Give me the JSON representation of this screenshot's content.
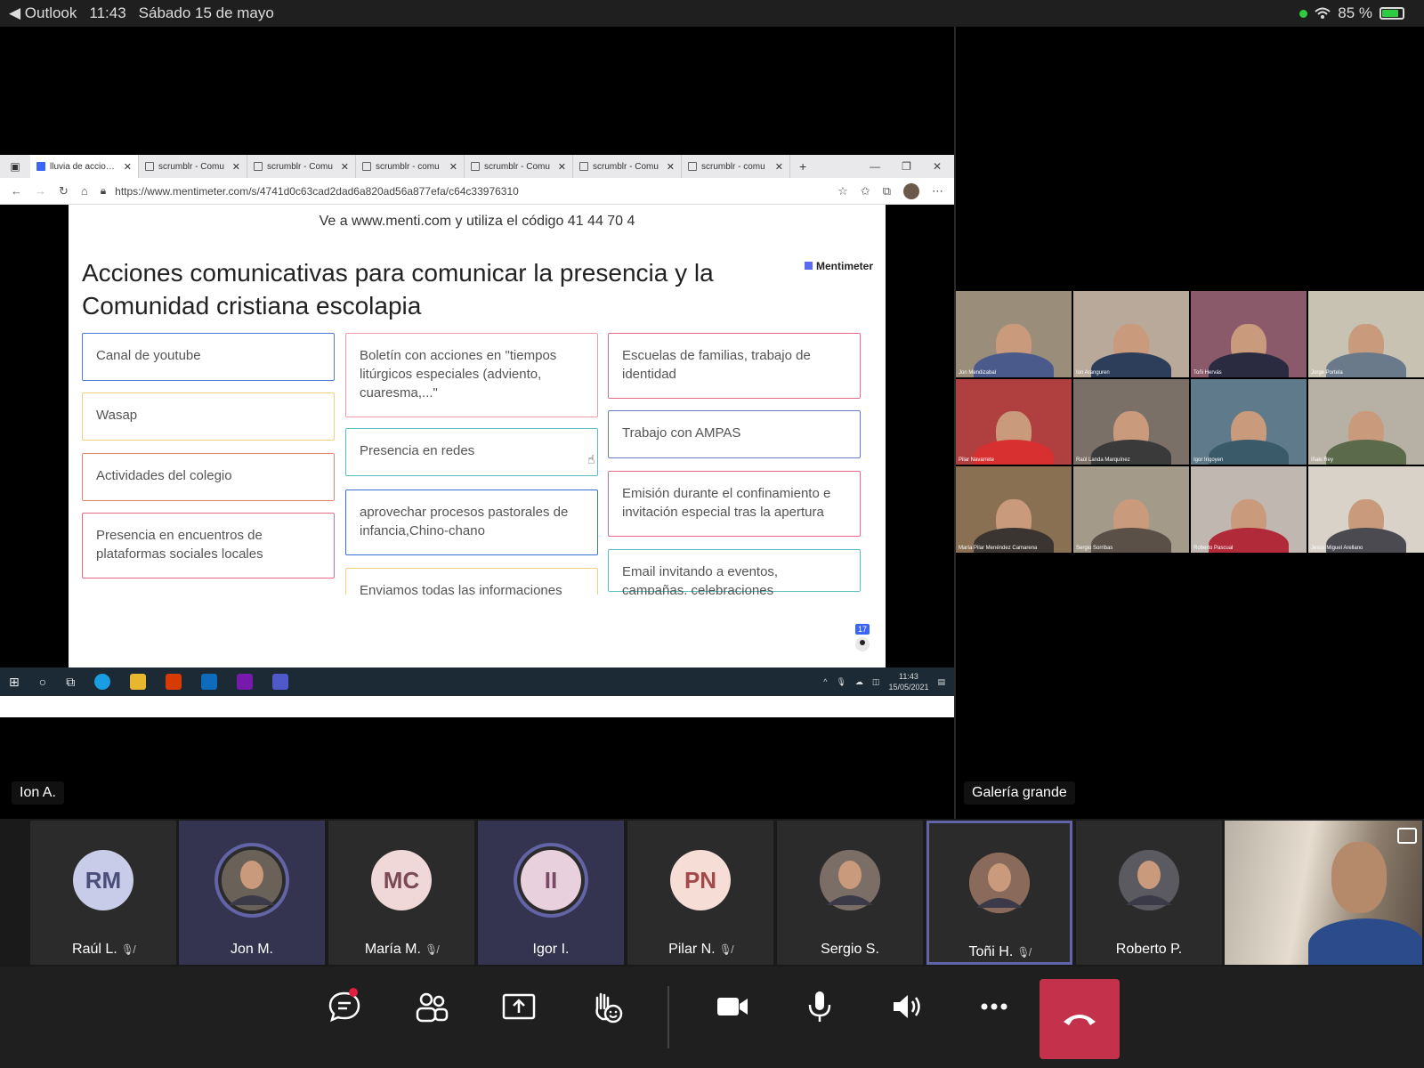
{
  "status_bar": {
    "back_app": "Outlook",
    "time": "11:43",
    "date": "Sábado 15 de mayo",
    "battery": "85 %",
    "battery_level": 0.85
  },
  "browser": {
    "tabs": [
      {
        "label": "lluvia de acciones"
      },
      {
        "label": "scrumblr - Comu"
      },
      {
        "label": "scrumblr - Comu"
      },
      {
        "label": "scrumblr - comu"
      },
      {
        "label": "scrumblr - Comu"
      },
      {
        "label": "scrumblr - Comu"
      },
      {
        "label": "scrumblr - comu"
      }
    ],
    "new_tab": "+",
    "url": "https://www.mentimeter.com/s/4741d0c63cad2dad6a820ad56a877efa/c64c33976310"
  },
  "slide": {
    "instruction": "Ve a www.menti.com y utiliza el código 41 44 70 4",
    "title": "Acciones comunicativas para comunicar la presencia y la Comunidad cristiana escolapia",
    "brand": "Mentimeter",
    "participants_count": "17",
    "columns": [
      [
        {
          "text": "Canal de youtube",
          "color": "#4a7fd6"
        },
        {
          "text": "Wasap",
          "color": "#f2cf7a"
        },
        {
          "text": "Actividades del colegio",
          "color": "#e2866a"
        },
        {
          "text": "Presencia en encuentros de plataformas sociales locales",
          "color": "#e86a86"
        }
      ],
      [
        {
          "text": "Boletín con acciones en \"tiempos litúrgicos especiales (adviento, cuaresma,...\"",
          "color": "#ef9aa8"
        },
        {
          "text": "Presencia en redes",
          "color": "#5bbfc2"
        },
        {
          "text": "aprovechar procesos pastorales de infancia,Chino-chano",
          "color": "#3b6fd1"
        },
        {
          "text": "Enviamos todas las informaciones",
          "color": "#f2cf7a"
        }
      ],
      [
        {
          "text": "Escuelas de familias, trabajo de identidad",
          "color": "#e86a86"
        },
        {
          "text": "Trabajo con AMPAS",
          "color": "#6a7ccf"
        },
        {
          "text": "Emisión durante el confinamiento e invitación especial tras la apertura",
          "color": "#e86a86"
        },
        {
          "text": "Email invitando a eventos, campañas, celebraciones",
          "color": "#5bbfc2"
        }
      ]
    ]
  },
  "taskbar": {
    "time": "11:43",
    "date": "15/05/2021"
  },
  "stage": {
    "presenter_name": "Ion A."
  },
  "gallery": {
    "label": "Galería grande",
    "tiles": [
      {
        "name": "Jon Mendizabal",
        "bg": "#9a8d7a",
        "shirt": "#4a5a8a"
      },
      {
        "name": "Ion Aranguren",
        "bg": "#b9a99a",
        "shirt": "#2c3e5a"
      },
      {
        "name": "Toñi Hervás",
        "bg": "#8a5a6a",
        "shirt": "#2a2a40"
      },
      {
        "name": "Jorge Portela",
        "bg": "#c8c2b2",
        "shirt": "#6a7a8a"
      },
      {
        "name": "Pilar Navarrete",
        "bg": "#b04040",
        "shirt": "#d83030"
      },
      {
        "name": "Raúl Landa Marquínez",
        "bg": "#7a7068",
        "shirt": "#3a3a3a"
      },
      {
        "name": "Igor Irigoyen",
        "bg": "#5f7a8a",
        "shirt": "#3a5a6a"
      },
      {
        "name": "Iñaki Rey",
        "bg": "#b7b0a5",
        "shirt": "#5a6a4a"
      },
      {
        "name": "María Pilar Menéndez Camarena",
        "bg": "#8a7052",
        "shirt": "#3a3530"
      },
      {
        "name": "Sergio Sorribas",
        "bg": "#a39a8a",
        "shirt": "#5a5048"
      },
      {
        "name": "Roberto Pascual",
        "bg": "#c0b8b0",
        "shirt": "#b02a3a"
      },
      {
        "name": "Jesús Miguel Arellano",
        "bg": "#d8d2c8",
        "shirt": "#4a4a50"
      }
    ]
  },
  "participants": [
    {
      "initials": "RM",
      "name": "Raúl L.",
      "muted": true,
      "avatar_color": "#c8cce8",
      "text_color": "#4a4f7a",
      "photo": false,
      "speaking": false,
      "selected": false
    },
    {
      "initials": "",
      "name": "Jon M.",
      "muted": false,
      "avatar_color": "#6a6258",
      "text_color": "#fff",
      "photo": true,
      "speaking": true,
      "selected": false
    },
    {
      "initials": "MC",
      "name": "María M.",
      "muted": true,
      "avatar_color": "#f0d8d8",
      "text_color": "#7a4a55",
      "photo": false,
      "speaking": false,
      "selected": false
    },
    {
      "initials": "II",
      "name": "Igor I.",
      "muted": false,
      "avatar_color": "#e8d0dc",
      "text_color": "#7a4a66",
      "photo": false,
      "speaking": true,
      "selected": false
    },
    {
      "initials": "PN",
      "name": "Pilar N.",
      "muted": true,
      "avatar_color": "#f6ddd6",
      "text_color": "#a24a4a",
      "photo": false,
      "speaking": false,
      "selected": false
    },
    {
      "initials": "",
      "name": "Sergio S.",
      "muted": false,
      "avatar_color": "#7a6e66",
      "text_color": "#fff",
      "photo": true,
      "speaking": false,
      "selected": false
    },
    {
      "initials": "",
      "name": "Toñi H.",
      "muted": true,
      "avatar_color": "#8a6a5a",
      "text_color": "#fff",
      "photo": true,
      "speaking": false,
      "selected": true
    },
    {
      "initials": "",
      "name": "Roberto P.",
      "muted": false,
      "avatar_color": "#5a5a60",
      "text_color": "#fff",
      "photo": true,
      "speaking": false,
      "selected": false
    }
  ],
  "controls": {
    "buttons": [
      {
        "icon": "chat-icon",
        "has_notification": true
      },
      {
        "icon": "participants-icon"
      },
      {
        "icon": "share-screen-icon"
      },
      {
        "icon": "raise-hand-icon"
      },
      {
        "icon": "camera-icon"
      },
      {
        "icon": "microphone-icon"
      },
      {
        "icon": "speaker-icon"
      },
      {
        "icon": "more-options-icon"
      }
    ],
    "hangup_color": "#c4314b"
  }
}
